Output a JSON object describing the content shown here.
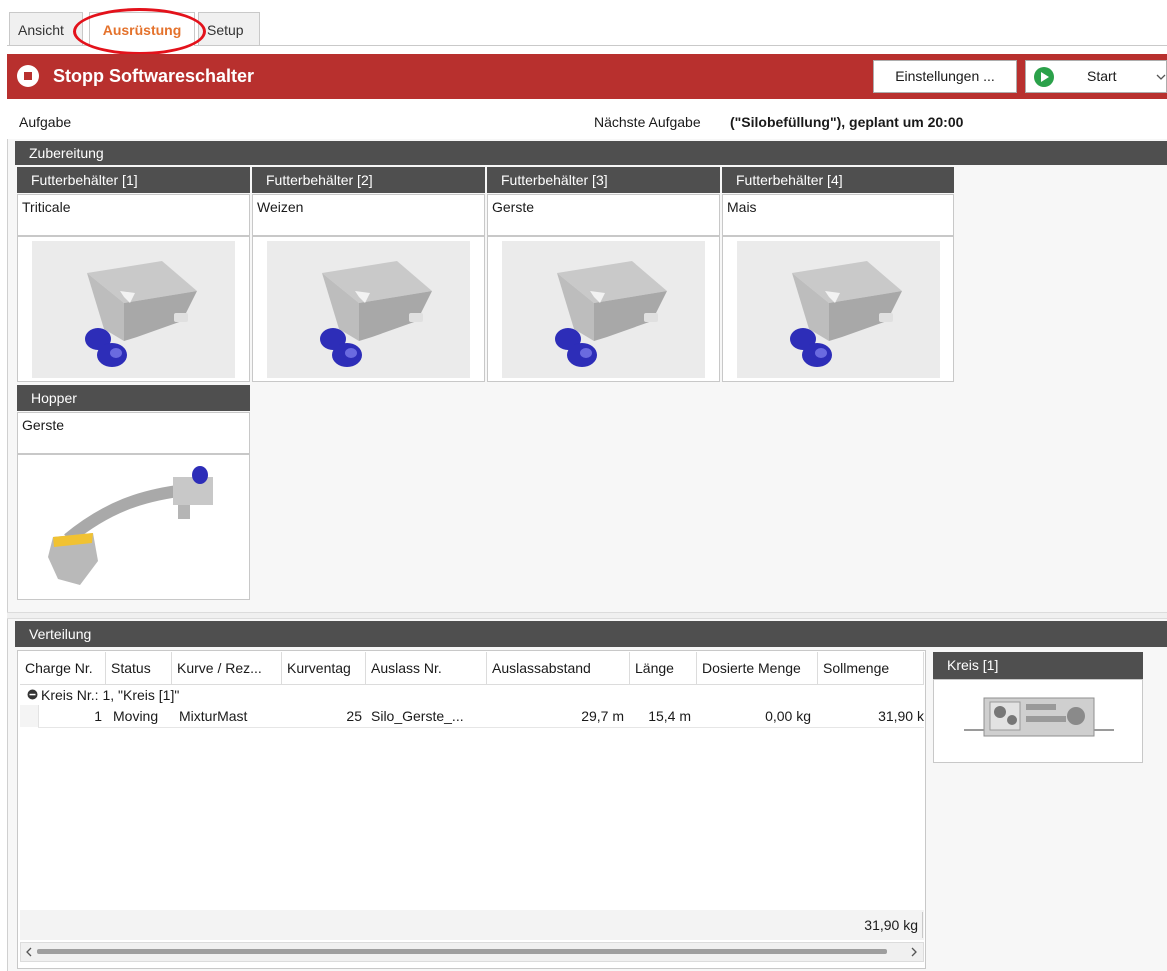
{
  "tabs": [
    {
      "label": "Ansicht"
    },
    {
      "label": "Ausrüstung"
    },
    {
      "label": "Setup"
    }
  ],
  "header": {
    "title": "Stopp Softwareschalter",
    "settings_button": "Einstellungen ...",
    "start_button": "Start"
  },
  "task_line": {
    "task_label": "Aufgabe",
    "next_label": "Nächste Aufgabe",
    "next_value": "(\"Silobefüllung\"), geplant um 20:00"
  },
  "preparation": {
    "title": "Zubereitung",
    "bins": [
      {
        "header": "Futterbehälter [1]",
        "content": "Triticale"
      },
      {
        "header": "Futterbehälter [2]",
        "content": "Weizen"
      },
      {
        "header": "Futterbehälter [3]",
        "content": "Gerste"
      },
      {
        "header": "Futterbehälter [4]",
        "content": "Mais"
      }
    ],
    "hopper": {
      "header": "Hopper",
      "content": "Gerste"
    }
  },
  "distribution": {
    "title": "Verteilung",
    "columns": [
      "Charge Nr.",
      "Status",
      "Kurve / Rez...",
      "Kurventag",
      "Auslass Nr.",
      "Auslassabstand",
      "Länge",
      "Dosierte Menge",
      "Sollmenge"
    ],
    "group_label": "Kreis Nr.: 1, \"Kreis [1]\"",
    "rows": [
      {
        "charge": "1",
        "status": "Moving",
        "curve": "MixturMast",
        "day": "25",
        "outlet": "Silo_Gerste_...",
        "distance": "29,7 m",
        "length": "15,4 m",
        "dosed": "0,00 kg",
        "target": "31,90 k"
      }
    ],
    "total": "31,90 kg",
    "circuit_panel": {
      "title": "Kreis [1]"
    }
  },
  "icons": {
    "stop": "stop-circle-icon",
    "play": "play-circle-icon",
    "dropdown": "chevron-down-icon",
    "collapse": "minus-circle-icon",
    "scroll_left": "scroll-left-icon",
    "scroll_right": "scroll-right-icon"
  },
  "colors": {
    "header_red": "#b8302e",
    "tab_active": "#e4722c",
    "section_gray": "#4f4f4f",
    "play_green": "#2ba14a",
    "motor_blue": "#3535c8",
    "highlight_ring": "#e3121b"
  }
}
